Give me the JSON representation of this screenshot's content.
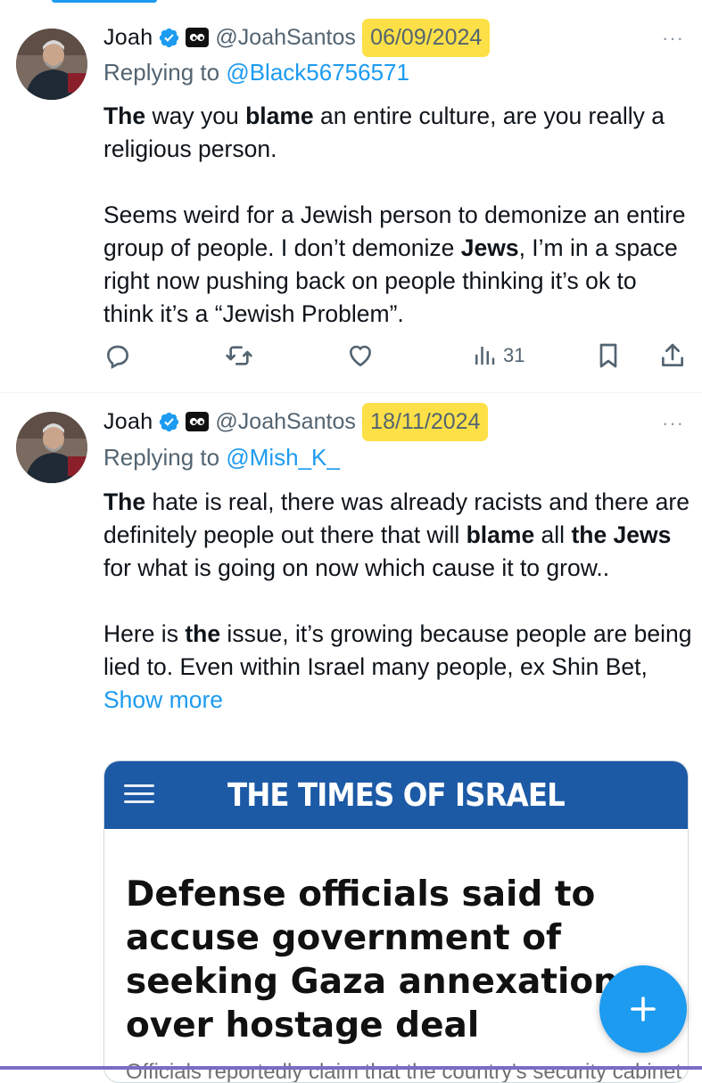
{
  "tweets": [
    {
      "name": "Joah",
      "handle": "@JoahSantos",
      "separator": "·",
      "date": "06/09/2024",
      "replying_prefix": "Replying to ",
      "replying_to": "@Black56756571",
      "more": "···",
      "views": "31"
    },
    {
      "name": "Joah",
      "handle": "@JoahSantos",
      "separator": "·",
      "date": "18/11/2024",
      "replying_prefix": "Replying to ",
      "replying_to": "@Mish_K_",
      "more": "···",
      "show_more": "Show more"
    }
  ],
  "card": {
    "brand": "THE TIMES OF ISRAEL",
    "headline": "Defense officials said to accuse government of seeking Gaza annexation over hostage deal",
    "subtext": "Officials reportedly claim that the country's security cabinet"
  },
  "colors": {
    "accent": "#1d9bf0",
    "highlight": "#fde047",
    "brand_bar": "#1c5aa6"
  },
  "icons": [
    "reply-icon",
    "retweet-icon",
    "like-icon",
    "views-icon",
    "bookmark-icon",
    "share-icon",
    "verified-icon",
    "compose-icon"
  ]
}
